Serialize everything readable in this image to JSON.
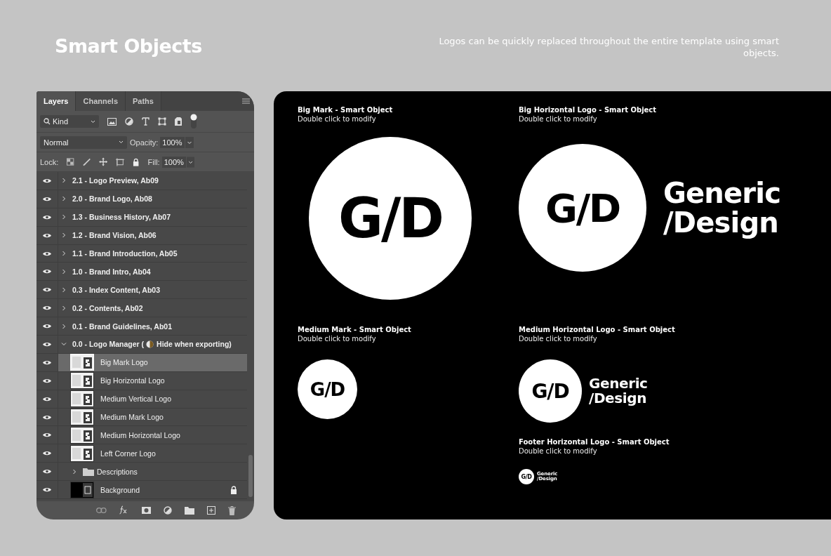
{
  "header": {
    "title": "Smart Objects",
    "caption": "Logos can be quickly replaced throughout the entire template using smart objects."
  },
  "layers_panel": {
    "tabs": [
      {
        "label": "Layers",
        "selected": true
      },
      {
        "label": "Channels",
        "selected": false
      },
      {
        "label": "Paths",
        "selected": false
      }
    ],
    "filter": {
      "value": "Kind"
    },
    "blend_mode": "Normal",
    "opacity_label": "Opacity:",
    "opacity": "100%",
    "lock_label": "Lock:",
    "fill_label": "Fill:",
    "fill": "100%",
    "layers": [
      {
        "kind": "group",
        "name": "2.1 - Logo Preview, Ab09",
        "visible": true,
        "expanded": false,
        "selected": false
      },
      {
        "kind": "group",
        "name": "2.0 - Brand Logo, Ab08",
        "visible": true,
        "expanded": false,
        "selected": false
      },
      {
        "kind": "group",
        "name": "1.3 - Business History, Ab07",
        "visible": true,
        "expanded": false,
        "selected": false
      },
      {
        "kind": "group",
        "name": "1.2 - Brand Vision, Ab06",
        "visible": true,
        "expanded": false,
        "selected": false
      },
      {
        "kind": "group",
        "name": "1.1 - Brand Introduction, Ab05",
        "visible": true,
        "expanded": false,
        "selected": false
      },
      {
        "kind": "group",
        "name": "1.0 - Brand Intro, Ab04",
        "visible": true,
        "expanded": false,
        "selected": false
      },
      {
        "kind": "group",
        "name": "0.3 - Index Content, Ab03",
        "visible": true,
        "expanded": false,
        "selected": false
      },
      {
        "kind": "group",
        "name": "0.2 - Contents, Ab02",
        "visible": true,
        "expanded": false,
        "selected": false
      },
      {
        "kind": "group",
        "name": "0.1 - Brand Guidelines, Ab01",
        "visible": true,
        "expanded": false,
        "selected": false
      },
      {
        "kind": "group",
        "name": "0.0 - Logo Manager (",
        "note": "Hide when exporting)",
        "visible": true,
        "expanded": true,
        "selected": false,
        "children": [
          {
            "kind": "smart",
            "name": "Big Mark Logo",
            "visible": true,
            "selected": true
          },
          {
            "kind": "smart",
            "name": "Big Horizontal Logo",
            "visible": true,
            "selected": false
          },
          {
            "kind": "smart",
            "name": "Medium Vertical Logo",
            "visible": true,
            "selected": false
          },
          {
            "kind": "smart",
            "name": "Medium Mark Logo",
            "visible": true,
            "selected": false
          },
          {
            "kind": "smart",
            "name": "Medium Horizontal Logo",
            "visible": true,
            "selected": false
          },
          {
            "kind": "smart",
            "name": "Left Corner Logo",
            "visible": true,
            "selected": false
          },
          {
            "kind": "folder",
            "name": "Descriptions",
            "visible": true,
            "expanded": false,
            "selected": false
          },
          {
            "kind": "background",
            "name": "Background",
            "visible": true,
            "selected": false,
            "locked": true
          }
        ]
      }
    ]
  },
  "canvas": {
    "columns": [
      [
        {
          "title": "Big Mark - Smart Object",
          "subtitle": "Double click to modify",
          "kind": "bigmark",
          "logo_text": "G/D"
        },
        {
          "title": "Medium Mark - Smart Object",
          "subtitle": "Double click to modify",
          "kind": "mediummark",
          "logo_text": "G/D"
        }
      ],
      [
        {
          "title": "Big Horizontal Logo - Smart Object",
          "subtitle": "Double click to modify",
          "kind": "bighorizontal",
          "logo_text": "G/D",
          "wordmark": [
            "Generic",
            "/Design"
          ]
        },
        {
          "title": "Medium Horizontal Logo - Smart Object",
          "subtitle": "Double click to modify",
          "kind": "mediumhorizontal",
          "logo_text": "G/D",
          "wordmark": [
            "Generic",
            "/Design"
          ]
        },
        {
          "title": "Footer Horizontal Logo - Smart Object",
          "subtitle": "Double click to modify",
          "kind": "footerhorizontal",
          "logo_text": "G/D",
          "wordmark": [
            "Generic",
            "/Design"
          ]
        }
      ]
    ]
  }
}
